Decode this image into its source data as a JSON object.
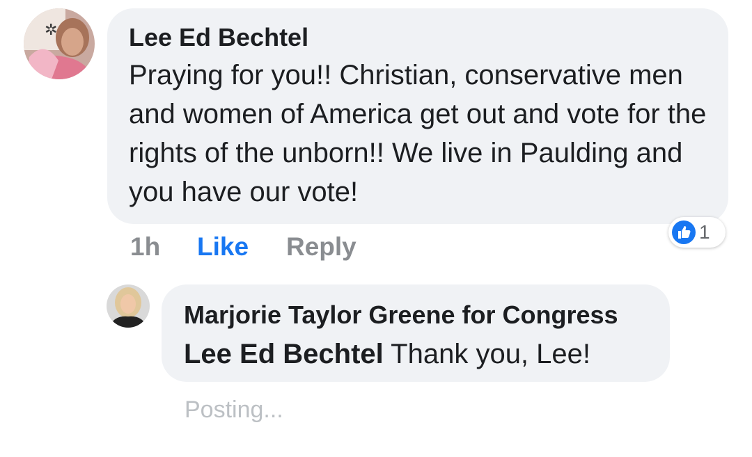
{
  "comment": {
    "author": "Lee Ed Bechtel",
    "text": "Praying for you!!  Christian, conservative men and women of America get out and vote for the rights of the unborn!!  We live in Paulding and you have our vote!",
    "time": "1h",
    "like_label": "Like",
    "reply_label": "Reply",
    "reaction_icon": "thumbs-up-icon",
    "reaction_count": "1"
  },
  "reply": {
    "author": "Marjorie Taylor Greene for Congress",
    "mention": "Lee Ed Bechtel",
    "text": "Thank you, Lee!",
    "status": "Posting..."
  },
  "colors": {
    "bubble": "#f0f2f5",
    "like_blue": "#1877f2",
    "meta_gray": "#8a8d91",
    "text": "#1c1e21"
  }
}
